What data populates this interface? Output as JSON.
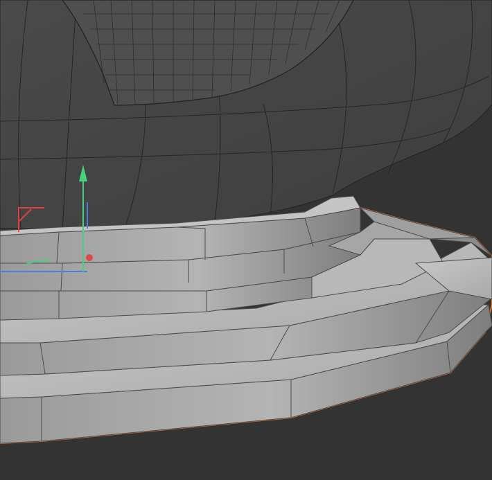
{
  "viewport": {
    "background_color": "#333333",
    "bowl_color": "#474747",
    "wire_color": "#222222",
    "step_top_color": "#bfbfbf",
    "step_front_color": "#9c9c9c",
    "selection_outline_color": "#e8752a"
  },
  "gizmo": {
    "x_axis_color": "#e04040",
    "y_axis_color": "#4a7fe0",
    "z_axis_color": "#43d37a",
    "origin_color": "#e04848"
  }
}
